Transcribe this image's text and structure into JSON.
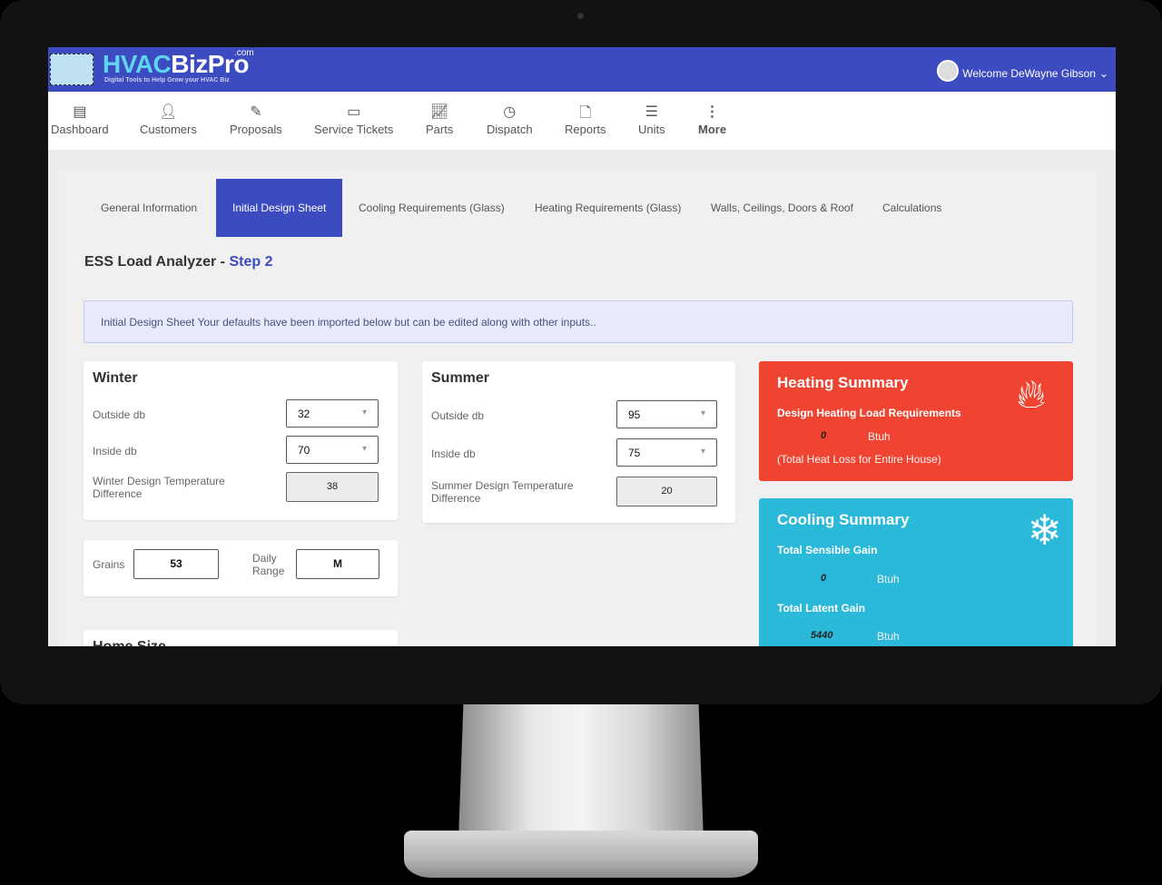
{
  "app": {
    "brand_hvac": "HVAC",
    "brand_rest": "BizPro",
    "brand_com": ".com",
    "tagline": "Digital Tools to Help Grow your HVAC Biz",
    "welcome": "Welcome DeWayne Gibson",
    "colors": {
      "primary": "#3c4bbf",
      "heating": "#ee4431",
      "cooling": "#2bb9d9"
    }
  },
  "nav": [
    {
      "label": "Dashboard",
      "icon": "dashboard-icon"
    },
    {
      "label": "Customers",
      "icon": "user-icon"
    },
    {
      "label": "Proposals",
      "icon": "edit-icon"
    },
    {
      "label": "Service Tickets",
      "icon": "credit-card-icon"
    },
    {
      "label": "Parts",
      "icon": "line-chart-icon"
    },
    {
      "label": "Dispatch",
      "icon": "clock-icon"
    },
    {
      "label": "Reports",
      "icon": "file-icon"
    },
    {
      "label": "Units",
      "icon": "database-icon"
    },
    {
      "label": "More",
      "icon": "more-vertical-icon"
    }
  ],
  "tabs": [
    "General Information",
    "Initial Design Sheet",
    "Cooling Requirements (Glass)",
    "Heating Requirements (Glass)",
    "Walls, Ceilings, Doors & Roof",
    "Calculations"
  ],
  "active_tab": "Initial Design Sheet",
  "page": {
    "title": "ESS Load Analyzer - ",
    "step": "Step 2",
    "alert": "Initial Design Sheet Your defaults have been imported below but can be edited along with other inputs.."
  },
  "winter": {
    "title": "Winter",
    "outside_label": "Outside db",
    "outside": "32",
    "inside_label": "Inside db",
    "inside": "70",
    "diff_label": "Winter Design Temperature Difference",
    "diff": "38"
  },
  "summer": {
    "title": "Summer",
    "outside_label": "Outside db",
    "outside": "95",
    "inside_label": "Inside db",
    "inside": "75",
    "diff_label": "Summer Design Temperature Difference",
    "diff": "20"
  },
  "grains": {
    "label": "Grains",
    "value": "53",
    "range_label": "Daily Range",
    "range": "M"
  },
  "home_size": {
    "title": "Home Size"
  },
  "heating": {
    "title": "Heating Summary",
    "sub": "Design Heating Load Requirements",
    "value": "0",
    "unit": "Btuh",
    "note": "(Total Heat Loss for Entire House)"
  },
  "cooling": {
    "title": "Cooling Summary",
    "sensible_label": "Total Sensible Gain",
    "sensible": "0",
    "latent_label": "Total Latent Gain",
    "latent": "5440",
    "unit": "Btuh"
  }
}
